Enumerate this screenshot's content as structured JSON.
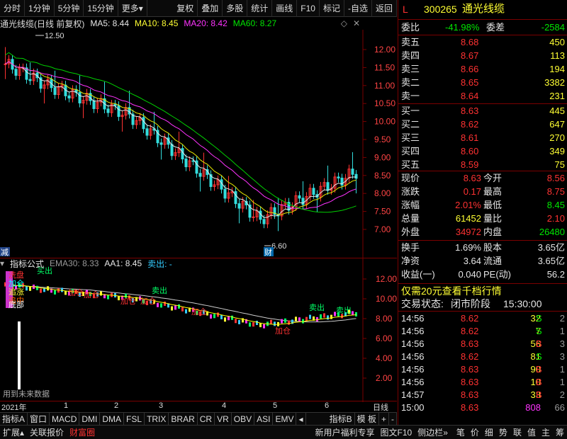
{
  "toolbar": {
    "items": [
      "分时",
      "1分钟",
      "5分钟",
      "15分钟",
      "更多"
    ],
    "right": [
      "复权",
      "叠加",
      "多股",
      "统计",
      "画线",
      "F10",
      "标记",
      "-自选",
      "返回"
    ]
  },
  "chart_header": {
    "title": "通光线缆(日线 前复权)",
    "ma5": "MA5: 8.44",
    "ma10": "MA10: 8.45",
    "ma20": "MA20: 8.42",
    "ma60": "MA60: 8.27",
    "high_label": "12.50",
    "low_label": "6.60",
    "low_tag": "财",
    "left_tag": "减"
  },
  "price_axis": [
    "12.00",
    "11.50",
    "11.00",
    "10.50",
    "10.00",
    "9.50",
    "9.00",
    "8.50",
    "8.00",
    "7.50",
    "7.00"
  ],
  "indicator_header": {
    "name": "指标公式",
    "ema": "EMA30: 8.33",
    "aa1": "AA1: 8.45",
    "sell": "卖出: -"
  },
  "indicator_axis": [
    "12.00",
    "10.00",
    "8.00",
    "6.00",
    "4.00",
    "2.00"
  ],
  "indicator_labels": {
    "left_tags": [
      "洗盘",
      "加仓",
      "追涨",
      "追中",
      "底部"
    ],
    "buy": "买出",
    "sell": "卖出",
    "add": "加仓",
    "note": "用到未来数据"
  },
  "time_axis": {
    "year": "2021年",
    "months": [
      "1",
      "2",
      "3",
      "4",
      "5",
      "6"
    ],
    "period": "日线"
  },
  "tabs": [
    "指标A",
    "窗口",
    "MACD",
    "DMI",
    "DMA",
    "FSL",
    "TRIX",
    "BRAR",
    "CR",
    "VR",
    "OBV",
    "ASI",
    "EMV"
  ],
  "tabs_right": [
    "指标B",
    "模 板",
    "+",
    "-"
  ],
  "statusbar": {
    "left": [
      "扩展",
      "关联报价",
      "财富圈"
    ],
    "middle": [
      "新用户福利专享",
      "图文F10",
      "侧边栏"
    ],
    "right": [
      "笔",
      "价",
      "细",
      "势",
      "联",
      "值",
      "主",
      "筹"
    ]
  },
  "quote": {
    "code": "300265",
    "name": "通光线缆",
    "flag": "L",
    "weibi_label": "委比",
    "weibi": "-41.98%",
    "weicha_label": "委差",
    "weicha": "-2584",
    "asks": [
      {
        "label": "卖五",
        "price": "8.68",
        "vol": "450"
      },
      {
        "label": "卖四",
        "price": "8.67",
        "vol": "113"
      },
      {
        "label": "卖三",
        "price": "8.66",
        "vol": "194"
      },
      {
        "label": "卖二",
        "price": "8.65",
        "vol": "3382"
      },
      {
        "label": "卖一",
        "price": "8.64",
        "vol": "231"
      }
    ],
    "bids": [
      {
        "label": "买一",
        "price": "8.63",
        "vol": "445"
      },
      {
        "label": "买二",
        "price": "8.62",
        "vol": "647"
      },
      {
        "label": "买三",
        "price": "8.61",
        "vol": "270"
      },
      {
        "label": "买四",
        "price": "8.60",
        "vol": "349"
      },
      {
        "label": "买五",
        "price": "8.59",
        "vol": "75"
      }
    ],
    "stats": [
      {
        "l1": "现价",
        "v1": "8.63",
        "l2": "今开",
        "v2": "8.56"
      },
      {
        "l1": "涨跌",
        "v1": "0.17",
        "l2": "最高",
        "v2": "8.75"
      },
      {
        "l1": "涨幅",
        "v1": "2.01%",
        "l2": "最低",
        "v2": "8.45"
      },
      {
        "l1": "总量",
        "v1": "61452",
        "l2": "量比",
        "v2": "2.10"
      },
      {
        "l1": "外盘",
        "v1": "34972",
        "l2": "内盘",
        "v2": "26480"
      }
    ],
    "stats2": [
      {
        "l1": "换手",
        "v1": "1.69%",
        "l2": "股本",
        "v2": "3.65亿"
      },
      {
        "l1": "净资",
        "v1": "3.64",
        "l2": "流通",
        "v2": "3.65亿"
      },
      {
        "l1": "收益(一)",
        "v1": "0.040",
        "l2": "PE(动)",
        "v2": "56.2"
      }
    ],
    "promo": "仅需20元查看千档行情",
    "status_label": "交易状态:",
    "status": "闭市阶段",
    "status_time": "15:30:00",
    "ticks": [
      {
        "t": "14:56",
        "p": "8.62",
        "v": "32",
        "s": "S",
        "n": "2"
      },
      {
        "t": "14:56",
        "p": "8.62",
        "v": "7",
        "s": "S",
        "n": "1"
      },
      {
        "t": "14:56",
        "p": "8.63",
        "v": "56",
        "s": "B",
        "n": "3"
      },
      {
        "t": "14:56",
        "p": "8.62",
        "v": "81",
        "s": "S",
        "n": "3"
      },
      {
        "t": "14:56",
        "p": "8.63",
        "v": "90",
        "s": "B",
        "n": "1"
      },
      {
        "t": "14:56",
        "p": "8.63",
        "v": "10",
        "s": "B",
        "n": "1"
      },
      {
        "t": "14:57",
        "p": "8.63",
        "v": "33",
        "s": "B",
        "n": "2"
      },
      {
        "t": "15:00",
        "p": "8.63",
        "v": "808",
        "s": "",
        "n": "66"
      }
    ]
  }
}
